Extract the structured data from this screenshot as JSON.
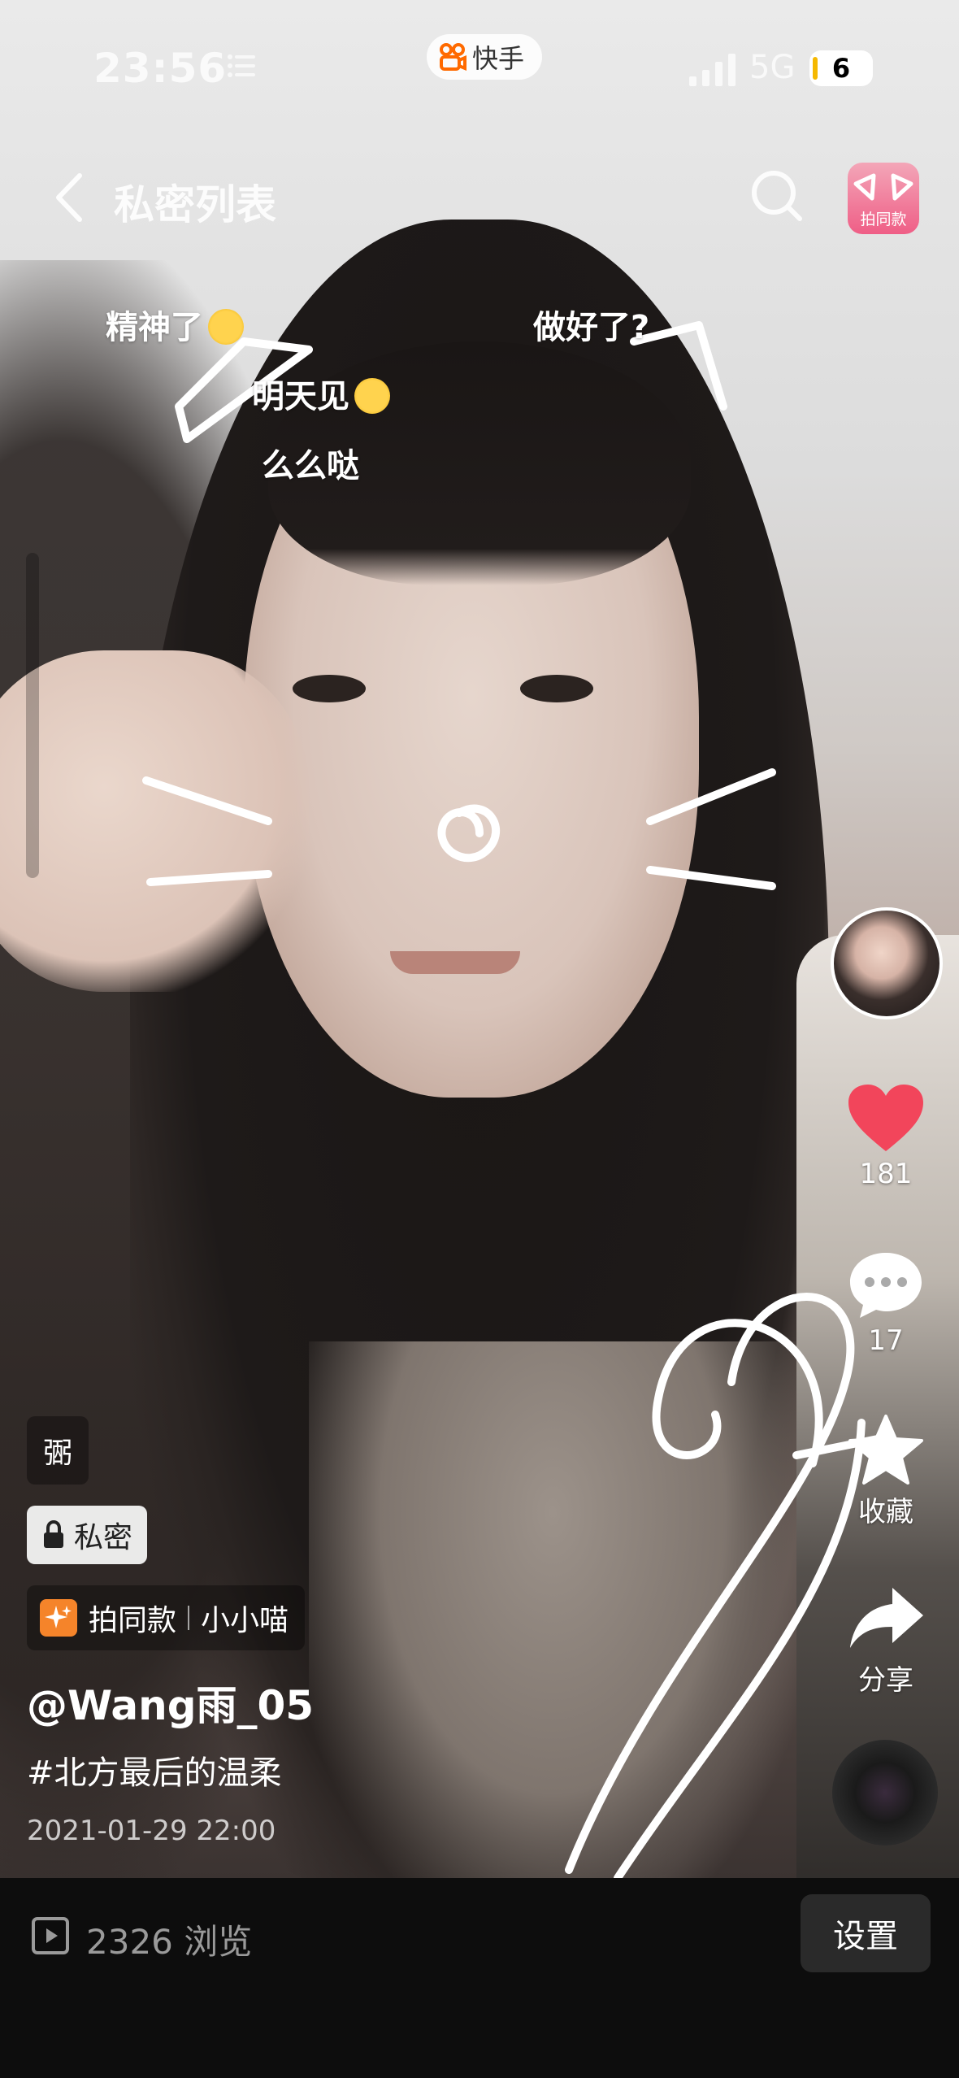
{
  "status_bar": {
    "time": "23:56",
    "app_name": "快手",
    "network": "5G",
    "battery": "6"
  },
  "nav": {
    "title": "私密列表",
    "same_style_badge": "拍同款"
  },
  "danmu": [
    {
      "text": "精神了"
    },
    {
      "text": "做好了?"
    },
    {
      "text": "明天见"
    },
    {
      "text": "么么哒"
    }
  ],
  "right_rail": {
    "likes": "181",
    "comments": "17",
    "favorite_label": "收藏",
    "share_label": "分享"
  },
  "post": {
    "tag": "弻",
    "private_label": "私密",
    "same_style_label": "拍同款",
    "effect_name": "小小喵",
    "username": "@Wang雨_05",
    "hashtag": "#北方最后的温柔",
    "date": "2021-01-29 22:00"
  },
  "bottom_bar": {
    "views": "2326 浏览",
    "settings_label": "设置"
  },
  "colors": {
    "like_heart": "#f2455b",
    "brand_orange": "#ff6a00",
    "badge_pink": "#ef5e86"
  }
}
